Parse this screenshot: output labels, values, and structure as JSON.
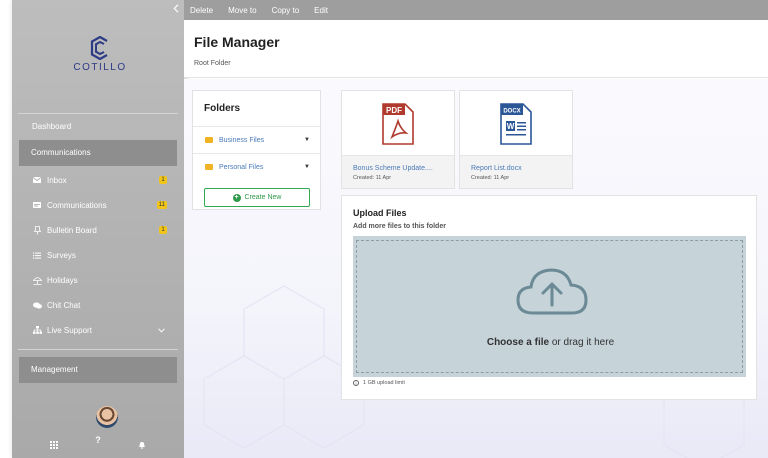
{
  "toolbar": {
    "delete": "Delete",
    "move_to": "Move to",
    "copy_to": "Copy to",
    "edit": "Edit"
  },
  "logo": {
    "text": "COTILLO"
  },
  "sidebar": {
    "dashboard": "Dashboard",
    "communications_header": "Communications",
    "items": [
      {
        "label": "Inbox",
        "icon": "envelope-icon",
        "badge": "1"
      },
      {
        "label": "Communications",
        "icon": "message-icon",
        "badge": "11"
      },
      {
        "label": "Bulletin Board",
        "icon": "pin-icon",
        "badge": "1"
      },
      {
        "label": "Surveys",
        "icon": "list-icon",
        "badge": ""
      },
      {
        "label": "Holidays",
        "icon": "umbrella-icon",
        "badge": ""
      },
      {
        "label": "Chit Chat",
        "icon": "chat-icon",
        "badge": ""
      },
      {
        "label": "Live Support",
        "icon": "org-icon",
        "badge": ""
      }
    ],
    "management_header": "Management"
  },
  "header": {
    "title": "File Manager",
    "breadcrumb": "Root Folder"
  },
  "folders": {
    "title": "Folders",
    "items": [
      {
        "label": "Business Files"
      },
      {
        "label": "Personal Files"
      }
    ],
    "create_label": "Create New"
  },
  "files": [
    {
      "type_label": "PDF",
      "name": "Bonus Scheme Update....",
      "date": "Created: 11 Apr"
    },
    {
      "type_label": "DOCX",
      "name": "Report List.docx",
      "date": "Created: 11 Apr"
    }
  ],
  "upload": {
    "title": "Upload Files",
    "subtitle": "Add more files to this folder",
    "choose": "Choose a file",
    "drag": " or drag it here",
    "limit": "1 GB upload limit"
  },
  "colors": {
    "accent": "#4a7ab8",
    "pdf": "#b03a2e",
    "docx": "#2b5797",
    "create": "#2e9a4a",
    "badge": "#f0c419"
  }
}
